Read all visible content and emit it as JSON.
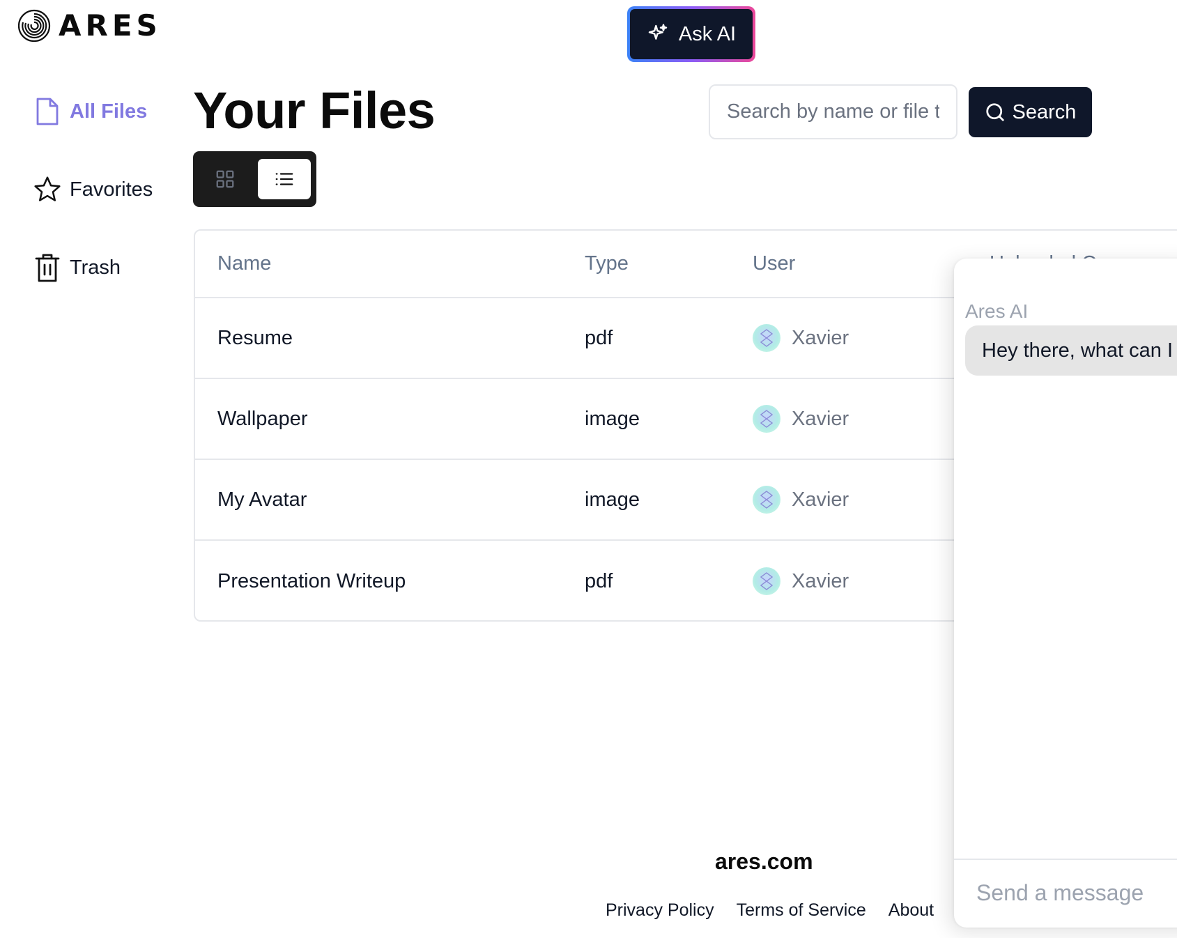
{
  "header": {
    "brand": "ARES",
    "ask_ai_label": "Ask AI"
  },
  "sidebar": {
    "items": [
      {
        "label": "All Files",
        "icon": "file-icon",
        "active": true
      },
      {
        "label": "Favorites",
        "icon": "star-icon",
        "active": false
      },
      {
        "label": "Trash",
        "icon": "trash-icon",
        "active": false
      }
    ]
  },
  "main": {
    "title": "Your Files",
    "search": {
      "placeholder": "Search by name or file type",
      "button_label": "Search"
    },
    "view_toggle": {
      "options": [
        "grid-icon",
        "list-icon"
      ],
      "selected": "list-icon"
    },
    "table": {
      "columns": [
        "Name",
        "Type",
        "User",
        "Uploaded On"
      ],
      "rows": [
        {
          "name": "Resume",
          "type": "pdf",
          "user": "Xavier"
        },
        {
          "name": "Wallpaper",
          "type": "image",
          "user": "Xavier"
        },
        {
          "name": "My Avatar",
          "type": "image",
          "user": "Xavier"
        },
        {
          "name": "Presentation Writeup",
          "type": "pdf",
          "user": "Xavier"
        }
      ]
    }
  },
  "footer": {
    "brand": "ares.com",
    "links": [
      "Privacy Policy",
      "Terms of Service",
      "About"
    ]
  },
  "chat": {
    "sender": "Ares AI",
    "message": "Hey there, what can I a",
    "input_placeholder": "Send a message"
  },
  "colors": {
    "accent": "#8179e0",
    "dark": "#0f172a",
    "border": "#e5e7eb"
  }
}
